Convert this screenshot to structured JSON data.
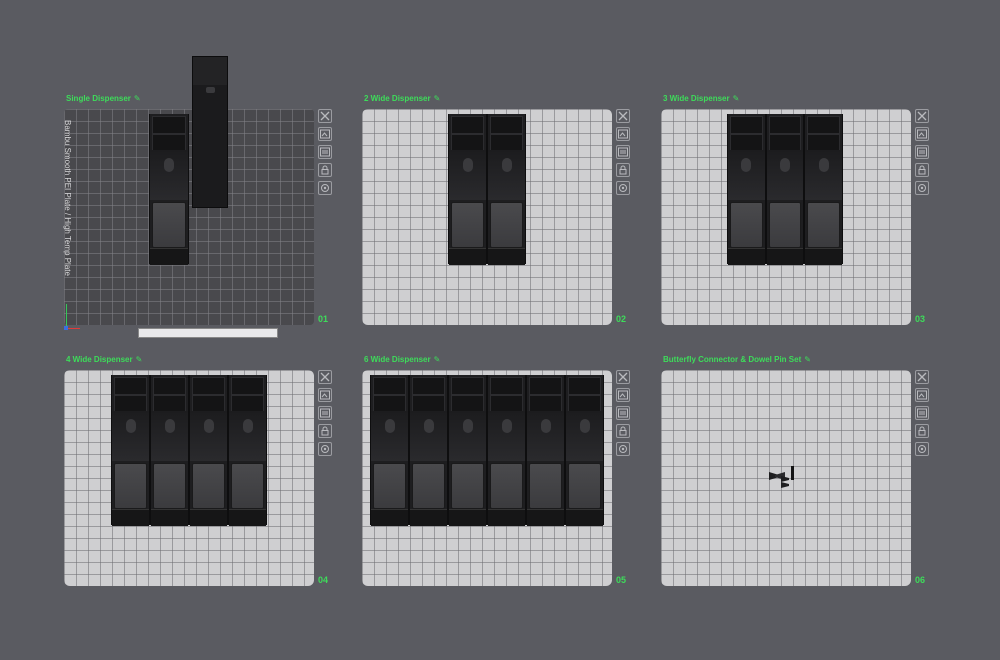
{
  "panels": [
    {
      "title": "Single Dispenser",
      "number": "01",
      "columns": 1
    },
    {
      "title": "2 Wide Dispenser",
      "number": "02",
      "columns": 2
    },
    {
      "title": "3 Wide Dispenser",
      "number": "03",
      "columns": 3
    },
    {
      "title": "4 Wide Dispenser",
      "number": "04",
      "columns": 4
    },
    {
      "title": "6 Wide Dispenser",
      "number": "05",
      "columns": 6
    },
    {
      "title": "Butterfly Connector & Dowel Pin Set",
      "number": "06",
      "columns": 0
    }
  ],
  "plate_label": "Bambu Smooth PEI Plate / High Temp Plate",
  "plate_footer": "",
  "toolbar_text": "",
  "colors": {
    "accent": "#3ddc5a",
    "background": "#5a5b61",
    "plate": "#cfcfd1"
  },
  "icons": [
    "close-icon",
    "arrange-icon",
    "orient-icon",
    "lock-icon",
    "settings-icon"
  ]
}
